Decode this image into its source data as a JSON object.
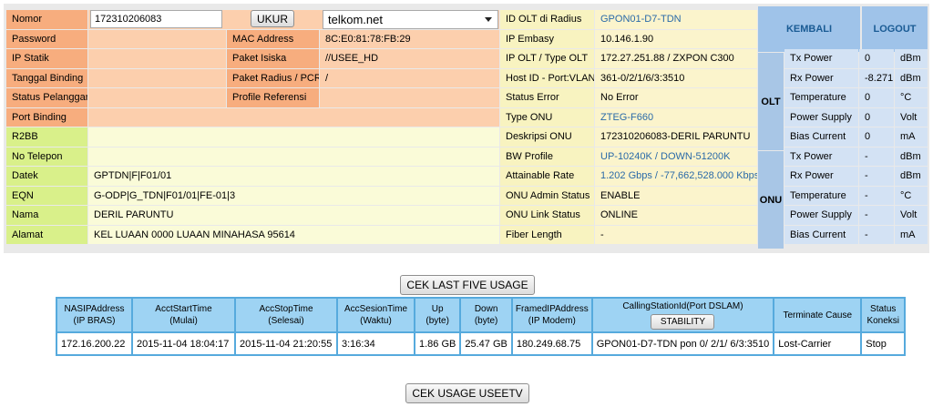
{
  "left_rows": [
    {
      "label": "Nomor"
    },
    {
      "label": "Password"
    },
    {
      "label": "IP Statik"
    },
    {
      "label": "Tanggal Binding"
    },
    {
      "label": "Status Pelanggan"
    },
    {
      "label": "Port Binding"
    },
    {
      "label": "R2BB"
    },
    {
      "label": "No Telepon"
    },
    {
      "label": "Datek",
      "value": "GPTDN|F|F01/01"
    },
    {
      "label": "EQN",
      "value": "G-ODP|G_TDN|F01/01|FE-01|3"
    },
    {
      "label": "Nama",
      "value": "DERIL PARUNTU"
    },
    {
      "label": "Alamat",
      "value": "KEL LUAAN 0000 LUAAN MINAHASA 95614"
    }
  ],
  "nomor_input_value": "172310206083",
  "ukur_button": "UKUR",
  "provider_select": "telkom.net",
  "mid_rows": [
    {
      "label": "MAC Address",
      "value": "8C:E0:81:78:FB:29"
    },
    {
      "label": "Paket Isiska",
      "value": "//USEE_HD"
    },
    {
      "label": "Paket Radius / PCRF",
      "value": "/"
    },
    {
      "label": "Profile Referensi",
      "value": ""
    }
  ],
  "right_rows": [
    {
      "label": "ID OLT di Radius",
      "value": "GPON01-D7-TDN",
      "link": true
    },
    {
      "label": "IP Embasy",
      "value": "10.146.1.90"
    },
    {
      "label": "IP OLT / Type OLT",
      "value": "172.27.251.88 / ZXPON C300"
    },
    {
      "label": "Host ID -  Port:VLAN",
      "value": "361-0/2/1/6/3:3510"
    },
    {
      "label": "Status Error",
      "value": "No Error"
    },
    {
      "label": "Type ONU",
      "value": "ZTEG-F660",
      "link": true
    },
    {
      "label": "Deskripsi ONU",
      "value": "172310206083-DERIL PARUNTU"
    },
    {
      "label": "BW Profile",
      "value": "UP-10240K / DOWN-51200K",
      "link": true
    },
    {
      "label": "Attainable Rate",
      "value": "1.202 Gbps / -77,662,528.000 Kbps",
      "link": true
    },
    {
      "label": "ONU Admin Status",
      "value": "ENABLE"
    },
    {
      "label": "ONU Link Status",
      "value": "ONLINE"
    },
    {
      "label": "Fiber Length",
      "value": "-"
    }
  ],
  "kembali_button": "KEMBALI",
  "logout_button": "LOGOUT",
  "olt_label": "OLT",
  "onu_label": "ONU",
  "olt_power": [
    {
      "name": "Tx Power",
      "value": "0",
      "unit": "dBm"
    },
    {
      "name": "Rx Power",
      "value": "-8.271",
      "unit": "dBm"
    },
    {
      "name": "Temperature",
      "value": "0",
      "unit": "°C"
    },
    {
      "name": "Power Supply",
      "value": "0",
      "unit": "Volt"
    },
    {
      "name": "Bias Current",
      "value": "0",
      "unit": "mA"
    }
  ],
  "onu_power": [
    {
      "name": "Tx Power",
      "value": "-",
      "unit": "dBm"
    },
    {
      "name": "Rx Power",
      "value": "-",
      "unit": "dBm"
    },
    {
      "name": "Temperature",
      "value": "-",
      "unit": "°C"
    },
    {
      "name": "Power Supply",
      "value": "-",
      "unit": "Volt"
    },
    {
      "name": "Bias Current",
      "value": "-",
      "unit": "mA"
    }
  ],
  "cek_last_five_button": "CEK LAST FIVE USAGE",
  "usage_table": {
    "headers": [
      [
        "NASIPAddress",
        "(IP BRAS)"
      ],
      [
        "AcctStartTime",
        "(Mulai)"
      ],
      [
        "AccStopTime",
        "(Selesai)"
      ],
      [
        "AccSesionTime",
        "(Waktu)"
      ],
      [
        "Up",
        "(byte)"
      ],
      [
        "Down",
        "(byte)"
      ],
      [
        "FramedIPAddress",
        "(IP Modem)"
      ],
      [
        "CallingStationId(Port DSLAM)",
        ""
      ],
      [
        "Terminate Cause",
        ""
      ],
      [
        "Status",
        "Koneksi"
      ]
    ],
    "stability_button": "STABILITY",
    "rows": [
      [
        "172.16.200.22",
        "2015-11-04 18:04:17",
        "2015-11-04 21:20:55",
        "3:16:34",
        "1.86 GB",
        "25.47 GB",
        "180.249.68.75",
        "GPON01-D7-TDN pon 0/ 2/1/ 6/3:3510",
        "Lost-Carrier",
        "Stop"
      ]
    ]
  },
  "cek_usage_useetv_button": "CEK USAGE USEETV"
}
